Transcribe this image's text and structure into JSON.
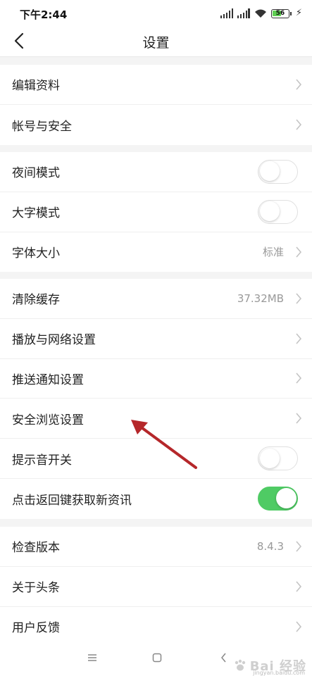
{
  "status_bar": {
    "time": "下午2:44",
    "battery_level": "56",
    "battery_fraction": 0.56,
    "signal_icon": "signal-icon",
    "wifi_icon": "wifi-icon"
  },
  "nav": {
    "title": "设置",
    "back_icon": "back-arrow-icon"
  },
  "groups": [
    {
      "items": [
        {
          "label": "编辑资料",
          "type": "link"
        },
        {
          "label": "帐号与安全",
          "type": "link"
        }
      ]
    },
    {
      "items": [
        {
          "label": "夜间模式",
          "type": "toggle",
          "on": false
        },
        {
          "label": "大字模式",
          "type": "toggle",
          "on": false
        },
        {
          "label": "字体大小",
          "type": "link",
          "value": "标准"
        }
      ]
    },
    {
      "items": [
        {
          "label": "清除缓存",
          "type": "link",
          "value": "37.32MB"
        },
        {
          "label": "播放与网络设置",
          "type": "link"
        },
        {
          "label": "推送通知设置",
          "type": "link"
        },
        {
          "label": "安全浏览设置",
          "type": "link"
        },
        {
          "label": "提示音开关",
          "type": "toggle",
          "on": false
        },
        {
          "label": "点击返回键获取新资讯",
          "type": "toggle",
          "on": true
        }
      ]
    },
    {
      "items": [
        {
          "label": "检查版本",
          "type": "link",
          "value": "8.4.3"
        },
        {
          "label": "关于头条",
          "type": "link"
        },
        {
          "label": "用户反馈",
          "type": "link"
        }
      ]
    }
  ],
  "bottom_nav": {
    "menu_icon": "menu-icon",
    "home_icon": "home-icon",
    "back_icon": "back-icon"
  },
  "colors": {
    "toggle_on": "#4fcb64",
    "annotation_arrow": "#b5272a",
    "background": "#f4f4f4"
  },
  "watermark": {
    "text": "Bai 经验",
    "sub": "jingyan.baidu.com"
  }
}
